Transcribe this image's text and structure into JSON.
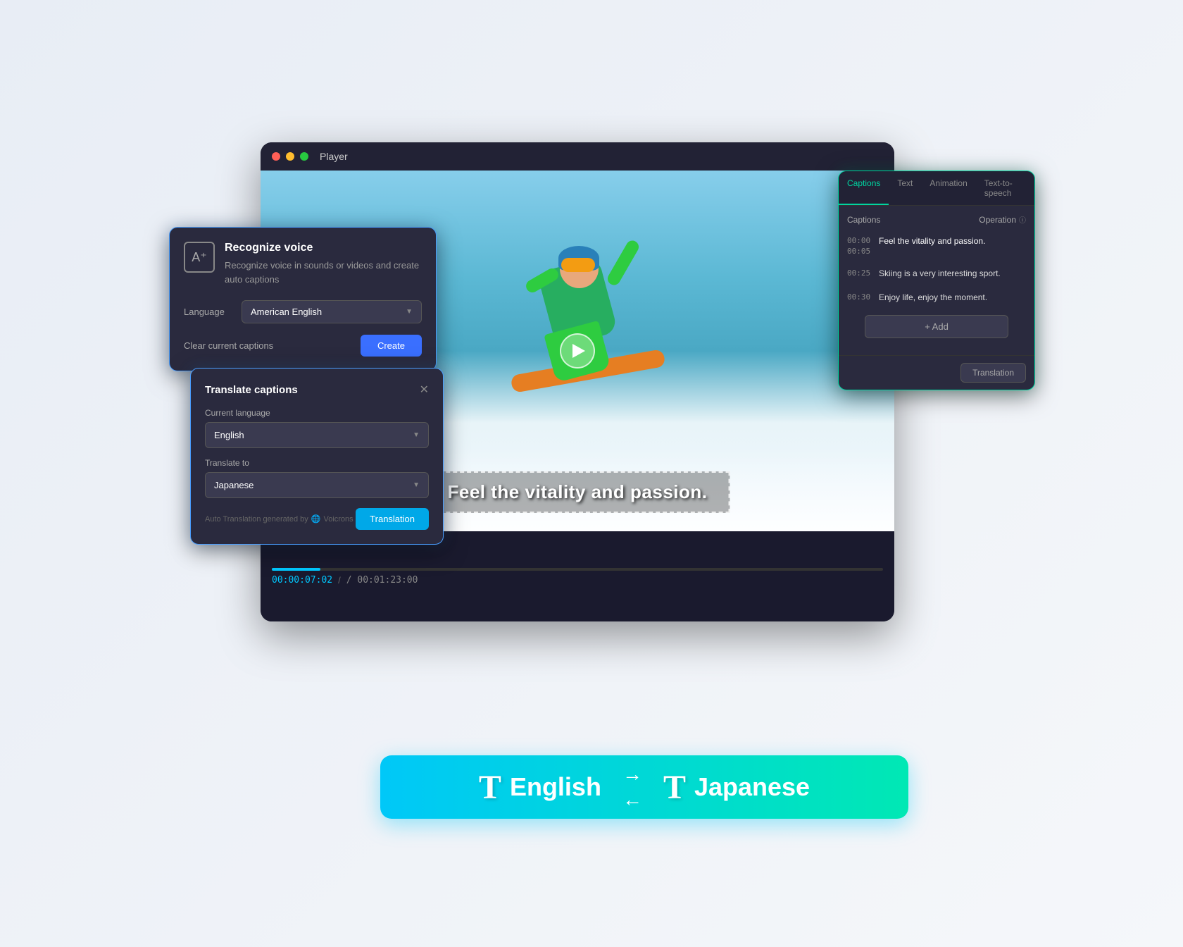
{
  "player": {
    "title": "Player",
    "caption_text": "Feel the vitality and passion.",
    "current_time": "00:00:07:02",
    "total_time": "/ 00:01:23:00"
  },
  "recognize_panel": {
    "title": "Recognize voice",
    "description": "Recognize voice in sounds or videos and create auto captions",
    "language_label": "Language",
    "language_value": "American English",
    "clear_label": "Clear current captions",
    "create_label": "Create"
  },
  "translate_panel": {
    "title": "Translate captions",
    "current_language_label": "Current language",
    "current_language_value": "English",
    "translate_to_label": "Translate to",
    "translate_to_value": "Japanese",
    "auto_translation_label": "Auto Translation generated by",
    "brand_name": "Voicrons",
    "button_label": "Translation"
  },
  "captions_panel": {
    "tabs": [
      "Captions",
      "Text",
      "Animation",
      "Text-to-speech"
    ],
    "active_tab": "Captions",
    "column_label": "Captions",
    "operation_label": "Operation",
    "items": [
      {
        "time": "00:00",
        "time2": "00:05",
        "lines": [
          "Feel the vitality and passion.",
          ""
        ]
      },
      {
        "time": "00:25",
        "time2": "",
        "lines": [
          "Skiing is a very interesting sport.",
          ""
        ]
      },
      {
        "time": "00:30",
        "time2": "",
        "lines": [
          "Enjoy life, enjoy the moment.",
          ""
        ]
      }
    ],
    "add_label": "+ Add",
    "footer_button": "Translation"
  },
  "translation_banner": {
    "from_lang": "English",
    "to_lang": "Japanese",
    "arrow_right": "→",
    "arrow_left": "←"
  }
}
